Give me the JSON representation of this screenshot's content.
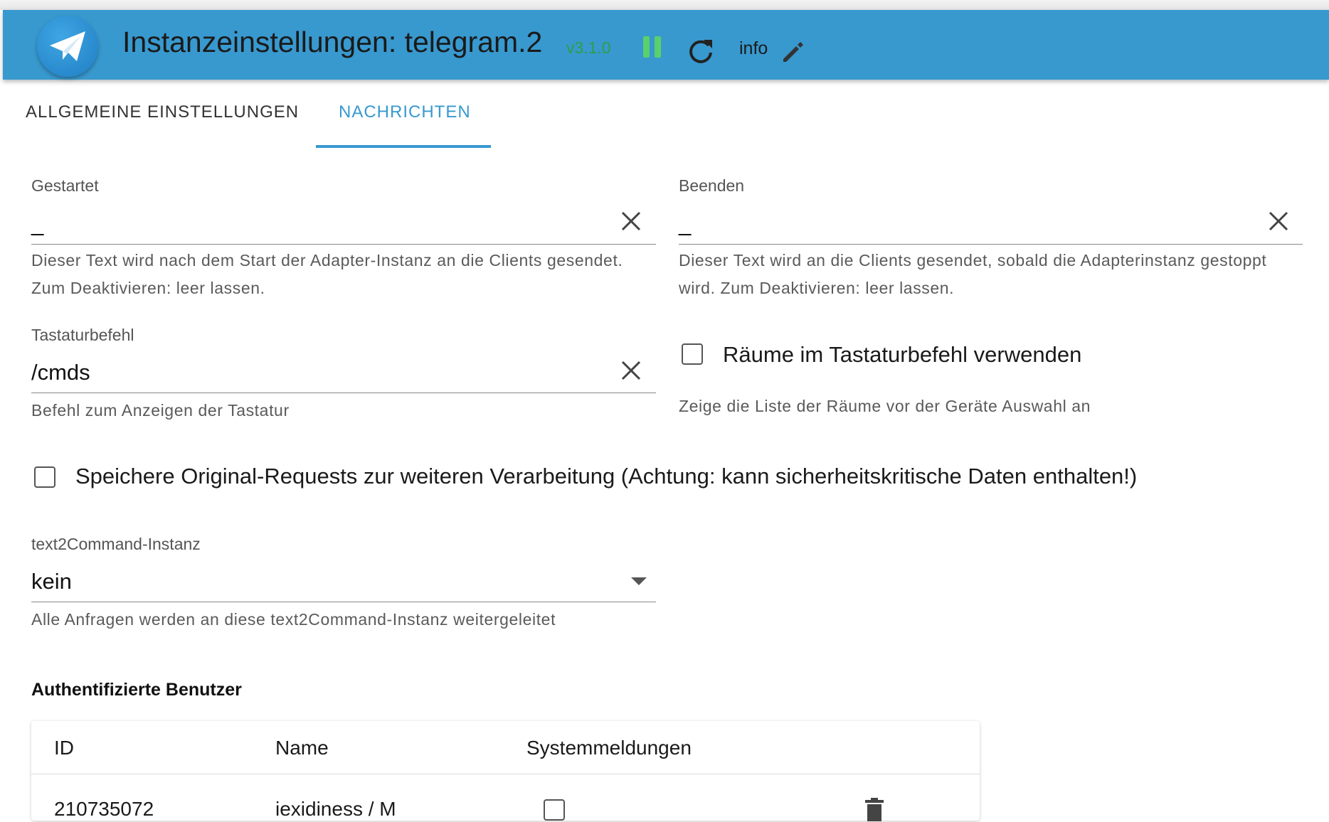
{
  "header": {
    "title": "Instanzeinstellungen: telegram.2",
    "version": "v3.1.0",
    "info_label": "info",
    "logo_icon": "telegram-paper-plane-icon",
    "colors": {
      "header_bg": "#3899cf",
      "version": "#2e9e47",
      "pause": "#5ad06a"
    }
  },
  "tabs": [
    {
      "label": "ALLGEMEINE EINSTELLUNGEN",
      "active": false
    },
    {
      "label": "NACHRICHTEN",
      "active": true
    }
  ],
  "fields": {
    "started": {
      "label": "Gestartet",
      "value": "_",
      "helper": "Dieser Text wird nach dem Start der Adapter-Instanz an die Clients gesendet. Zum Deaktivieren: leer lassen."
    },
    "stopped": {
      "label": "Beenden",
      "value": "_",
      "helper": "Dieser Text wird an die Clients gesendet, sobald die Adapterinstanz gestoppt wird. Zum Deaktivieren: leer lassen."
    },
    "keyboard": {
      "label": "Tastaturbefehl",
      "value": "/cmds",
      "helper": "Befehl zum Anzeigen der Tastatur"
    },
    "rooms": {
      "label": "Räume im Tastaturbefehl verwenden",
      "checked": false,
      "helper": "Zeige die Liste der Räume vor der Geräte Auswahl an"
    },
    "store_raw": {
      "label": "Speichere Original-Requests zur weiteren Verarbeitung (Achtung: kann sicherheitskritische Daten enthalten!)",
      "checked": false
    },
    "text2command": {
      "label": "text2Command-Instanz",
      "value": "kein",
      "helper": "Alle Anfragen werden an diese text2Command-Instanz weitergeleitet"
    }
  },
  "users": {
    "title": "Authentifizierte Benutzer",
    "columns": [
      "ID",
      "Name",
      "Systemmeldungen"
    ],
    "rows": [
      {
        "id": "210735072",
        "name": "iexidiness / M",
        "system_messages": false
      }
    ]
  }
}
